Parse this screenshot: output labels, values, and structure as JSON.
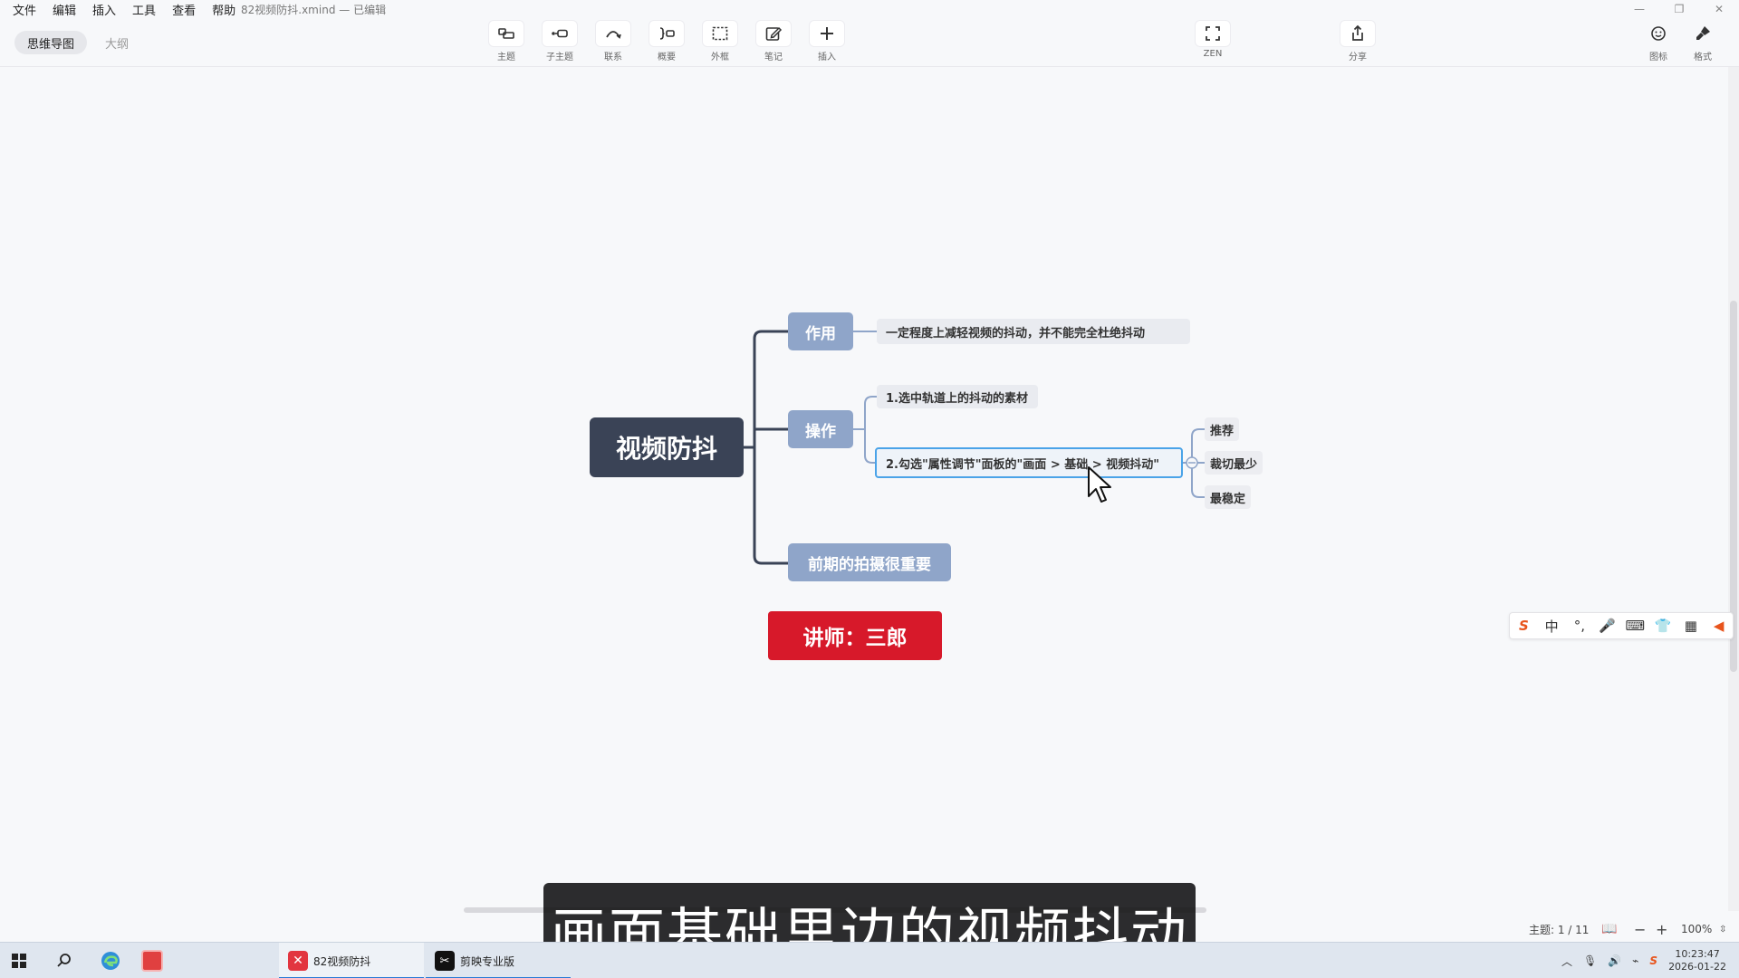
{
  "menubar": {
    "items": [
      "文件",
      "编辑",
      "插入",
      "工具",
      "查看",
      "帮助"
    ],
    "doc_title": "82视频防抖.xmind",
    "doc_status": "— 已编辑"
  },
  "view_tabs": {
    "mindmap": "思维导图",
    "outline": "大纲"
  },
  "toolbar": {
    "topic": {
      "label": "主题",
      "icon": "topic-icon"
    },
    "subtopic": {
      "label": "子主题",
      "icon": "subtopic-icon"
    },
    "relationship": {
      "label": "联系",
      "icon": "relationship-icon"
    },
    "summary": {
      "label": "概要",
      "icon": "summary-icon"
    },
    "boundary": {
      "label": "外框",
      "icon": "boundary-icon"
    },
    "notes": {
      "label": "笔记",
      "icon": "notes-icon"
    },
    "insert": {
      "label": "插入",
      "icon": "plus-icon"
    },
    "zen": {
      "label": "ZEN",
      "icon": "fullscreen-icon"
    },
    "share": {
      "label": "分享",
      "icon": "share-icon"
    },
    "icon_panel": {
      "label": "图标",
      "icon": "smiley-icon"
    },
    "format": {
      "label": "格式",
      "icon": "brush-icon"
    }
  },
  "mindmap": {
    "central": "视频防抖",
    "branches": [
      {
        "label": "作用",
        "children": [
          {
            "label": "一定程度上减轻视频的抖动，并不能完全杜绝抖动"
          }
        ]
      },
      {
        "label": "操作",
        "children": [
          {
            "label": "1.选中轨道上的抖动的素材"
          },
          {
            "label": "2.勾选\"属性调节\"面板的\"画面 > 基础 > 视频抖动\"",
            "children": [
              "推荐",
              "裁切最少",
              "最稳定"
            ]
          }
        ]
      },
      {
        "label": "前期的拍摄很重要"
      }
    ],
    "floating": "讲师：三郎"
  },
  "ime_bar": {
    "items": [
      "S",
      "中",
      "°,",
      "🎤",
      "⌨",
      "👕",
      "▦",
      "◀"
    ]
  },
  "status": {
    "topic_count": "主题: 1 / 11",
    "zoom": "100%"
  },
  "subtitle": "画面基础里边的视频抖动",
  "taskbar": {
    "apps": [
      {
        "label": "82视频防抖",
        "icon": "xmind-icon"
      },
      {
        "label": "剪映专业版",
        "icon": "jianying-icon"
      }
    ],
    "clock_time": "10:23:47",
    "clock_date": "2026-01-22"
  }
}
